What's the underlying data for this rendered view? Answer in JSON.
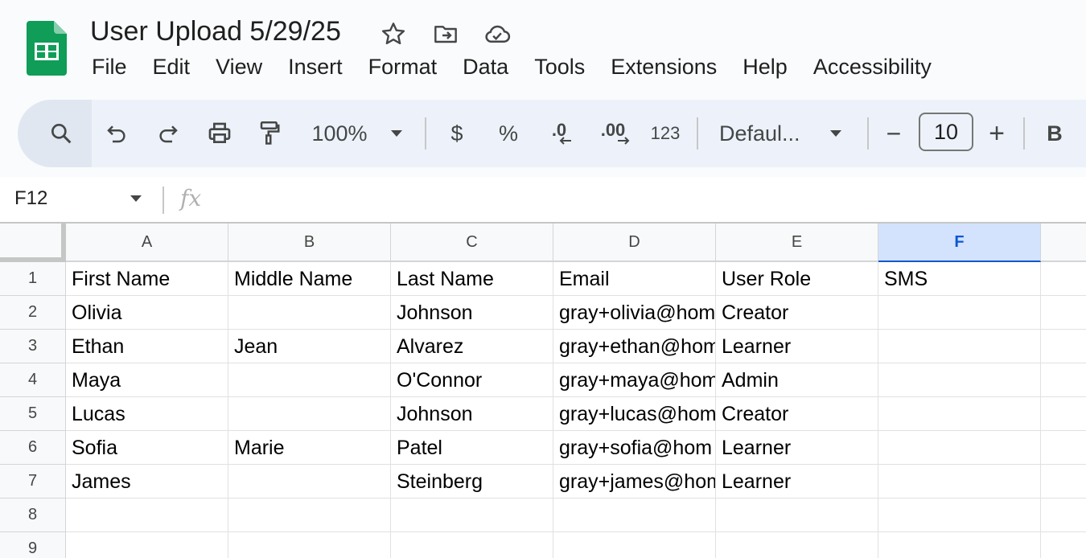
{
  "app": {
    "doc_title": "User Upload 5/29/25",
    "title_icons": [
      "star-icon",
      "move-to-folder-icon",
      "cloud-saved-icon"
    ],
    "menu": [
      "File",
      "Edit",
      "View",
      "Insert",
      "Format",
      "Data",
      "Tools",
      "Extensions",
      "Help",
      "Accessibility"
    ]
  },
  "toolbar": {
    "zoom": "100%",
    "currency": "$",
    "percent": "%",
    "decrease_decimal": ".0",
    "increase_decimal": ".00",
    "number_format": "123",
    "font": "Defaul...",
    "font_size": "10",
    "decrease_font": "−",
    "increase_font": "+",
    "bold": "B"
  },
  "formula_bar": {
    "name_box": "F12",
    "fx": "fx",
    "formula": ""
  },
  "sheet": {
    "columns": [
      "A",
      "B",
      "C",
      "D",
      "E",
      "F"
    ],
    "selected_column": "F",
    "row_numbers": [
      "1",
      "2",
      "3",
      "4",
      "5",
      "6",
      "7",
      "8",
      "9"
    ],
    "rows": [
      [
        "First Name",
        "Middle Name",
        "Last Name",
        "Email",
        "User Role",
        "SMS"
      ],
      [
        "Olivia",
        "",
        "Johnson",
        "gray+olivia@hom",
        "Creator",
        ""
      ],
      [
        "Ethan",
        "Jean",
        "Alvarez",
        "gray+ethan@hom",
        "Learner",
        ""
      ],
      [
        "Maya",
        "",
        "O'Connor",
        "gray+maya@hom",
        "Admin",
        ""
      ],
      [
        "Lucas",
        "",
        "Johnson",
        "gray+lucas@hom",
        "Creator",
        ""
      ],
      [
        "Sofia",
        "Marie",
        "Patel",
        "gray+sofia@hom",
        "Learner",
        ""
      ],
      [
        "James",
        "",
        "Steinberg",
        "gray+james@hom",
        "Learner",
        ""
      ],
      [
        "",
        "",
        "",
        "",
        "",
        ""
      ],
      [
        "",
        "",
        "",
        "",
        "",
        ""
      ]
    ]
  },
  "colors": {
    "sheets_green": "#0f9d58",
    "selected_header": "#d3e3fd",
    "toolbar_bg": "#edf2fa"
  }
}
